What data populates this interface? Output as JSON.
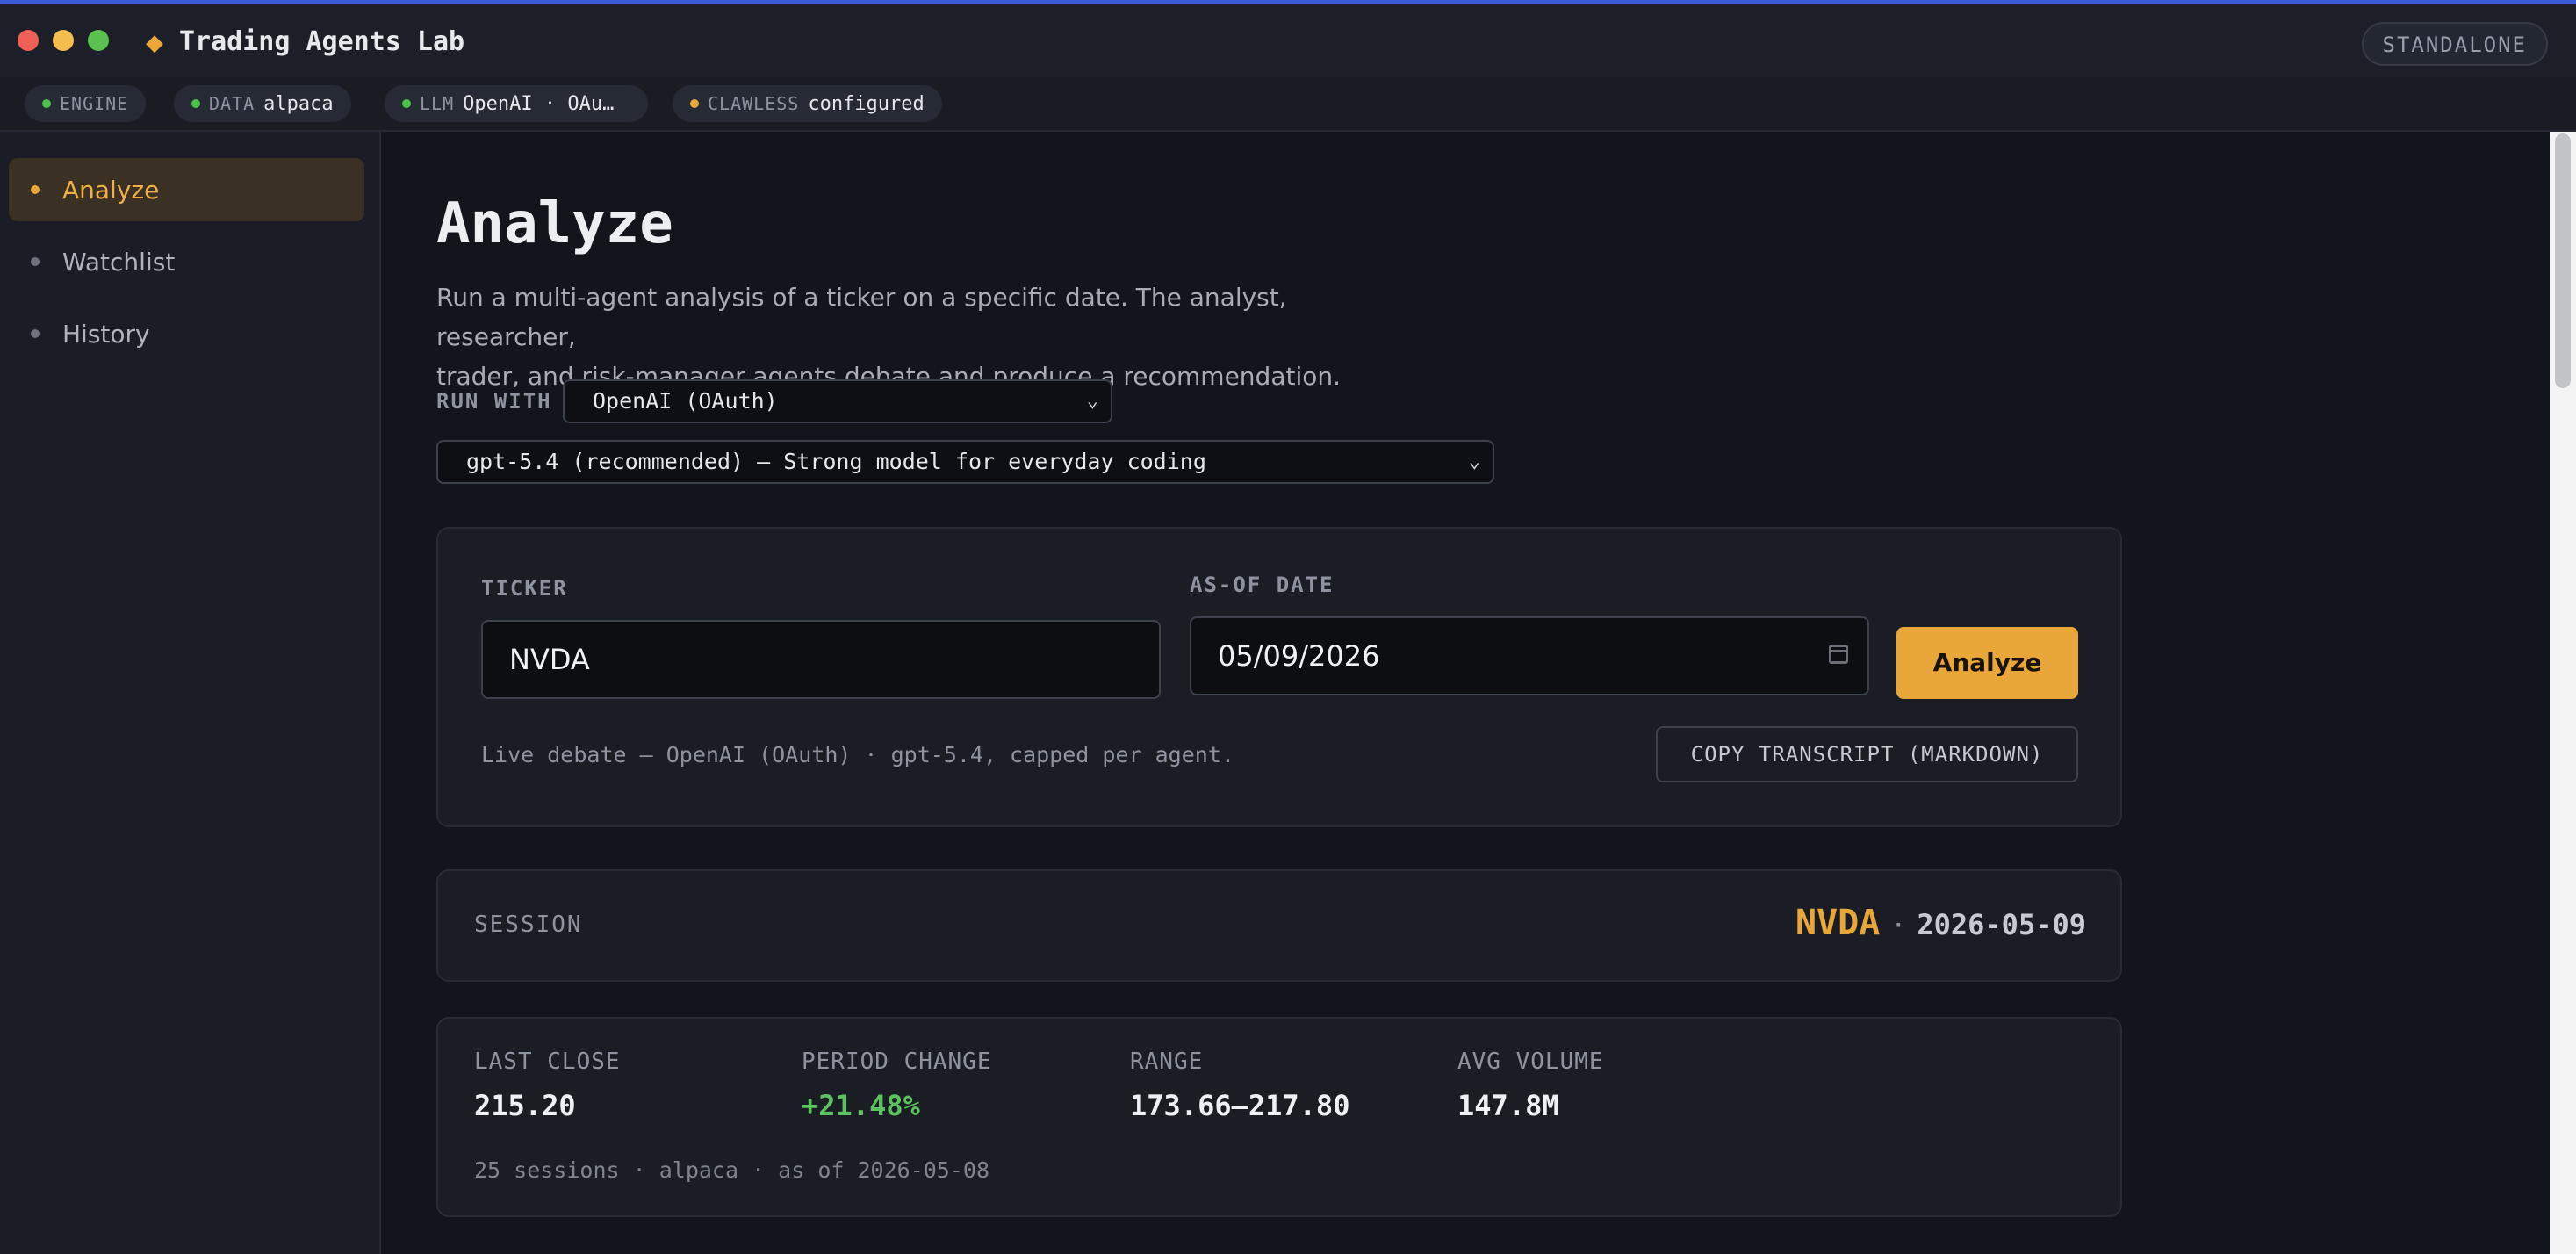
{
  "window": {
    "title": "Trading Agents Lab",
    "mode_badge": "STANDALONE"
  },
  "status": {
    "engine": {
      "key": "ENGINE",
      "value": "",
      "color": "#4cc24a"
    },
    "data": {
      "key": "DATA",
      "value": "alpaca",
      "color": "#4cc24a"
    },
    "llm": {
      "key": "LLM",
      "value": "OpenAI · OAu…",
      "color": "#4cc24a"
    },
    "clawless": {
      "key": "CLAWLESS",
      "value": "configured",
      "color": "#e9a73a"
    }
  },
  "sidebar": {
    "items": [
      {
        "label": "Analyze",
        "active": true
      },
      {
        "label": "Watchlist",
        "active": false
      },
      {
        "label": "History",
        "active": false
      }
    ]
  },
  "page": {
    "title": "Analyze",
    "description_line1": "Run a multi-agent analysis of a ticker on a specific date. The analyst, researcher,",
    "description_line2": "trader, and risk-manager agents debate and produce a recommendation.",
    "run_with_label": "RUN WITH",
    "provider_selected": "OpenAI (OAuth)",
    "model_selected": "gpt-5.4 (recommended) — Strong model for everyday coding"
  },
  "form": {
    "ticker_label": "TICKER",
    "ticker_value": "NVDA",
    "date_label": "AS-OF DATE",
    "date_value": "05/09/2026",
    "analyze_button": "Analyze",
    "hint": "Live debate — OpenAI (OAuth) · gpt-5.4, capped per agent.",
    "copy_button": "COPY TRANSCRIPT (MARKDOWN)"
  },
  "session": {
    "label": "SESSION",
    "ticker": "NVDA",
    "separator": "·",
    "date": "2026-05-09"
  },
  "stats": {
    "last_close": {
      "label": "LAST CLOSE",
      "value": "215.20"
    },
    "period_change": {
      "label": "PERIOD CHANGE",
      "value": "+21.48%"
    },
    "range": {
      "label": "RANGE",
      "value": "173.66–217.80"
    },
    "avg_volume": {
      "label": "AVG VOLUME",
      "value": "147.8M"
    },
    "footnote": "25 sessions · alpaca · as of 2026-05-08"
  },
  "colors": {
    "accent": "#e9a73a",
    "positive": "#5cc25f"
  }
}
